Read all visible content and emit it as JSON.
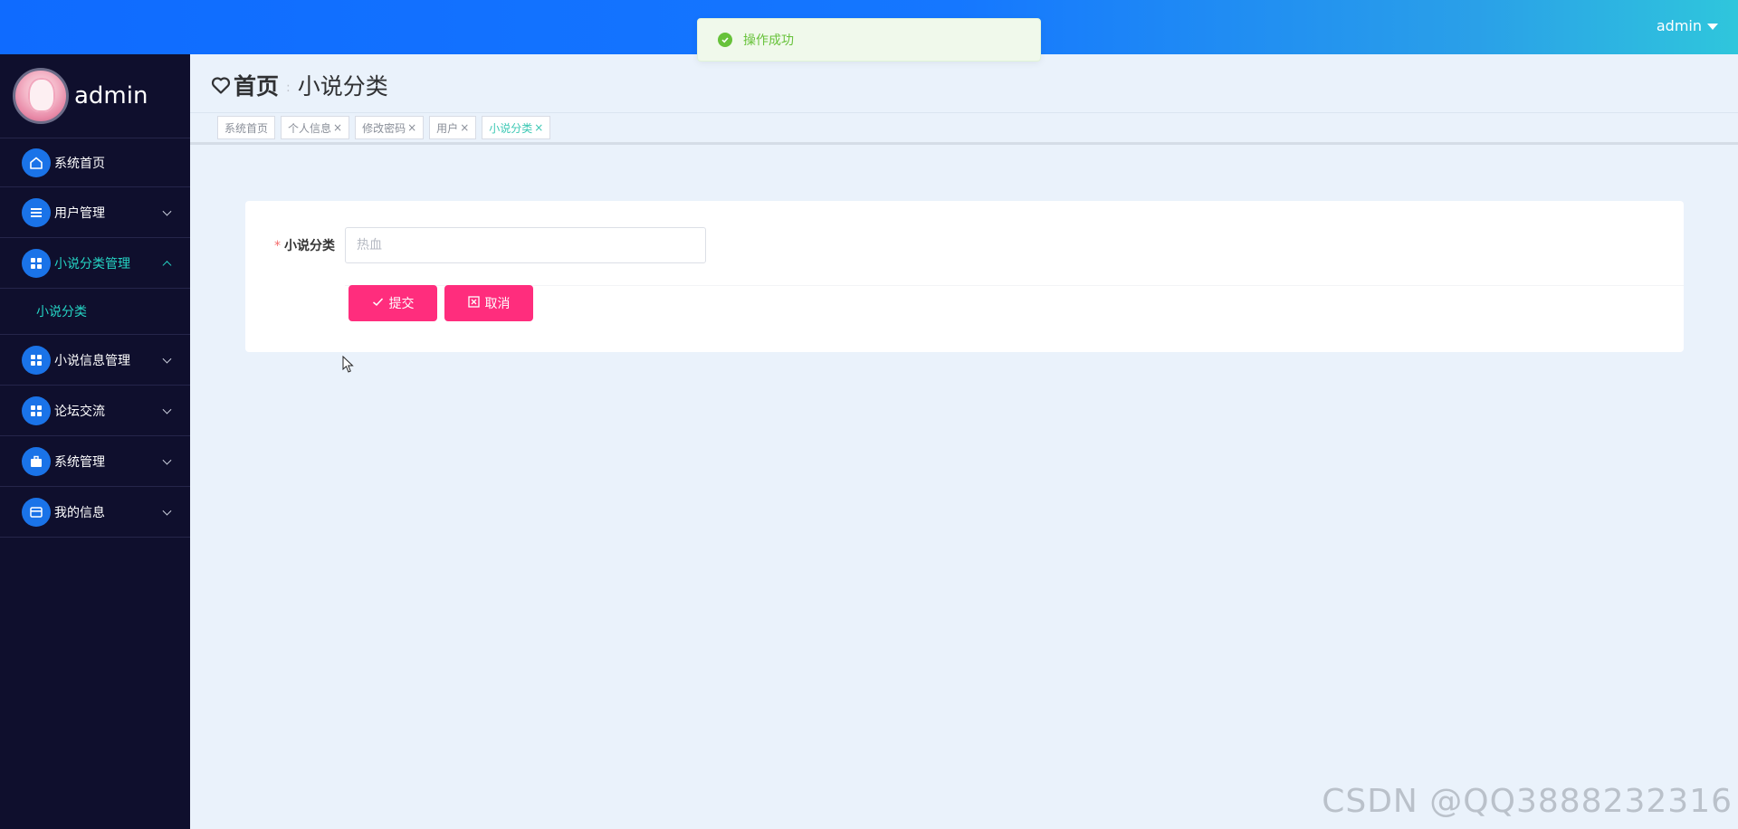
{
  "topbar": {
    "user_label": "admin"
  },
  "toast": {
    "message": "操作成功",
    "color": "#67c23a"
  },
  "sidebar": {
    "profile_name": "admin",
    "items": [
      {
        "label": "系统首页",
        "icon": "home-icon"
      },
      {
        "label": "用户管理",
        "icon": "list-icon"
      },
      {
        "label": "小说分类管理",
        "icon": "grid-icon",
        "expanded": true,
        "children": [
          {
            "label": "小说分类"
          }
        ]
      },
      {
        "label": "小说信息管理",
        "icon": "grid-icon"
      },
      {
        "label": "论坛交流",
        "icon": "grid-icon"
      },
      {
        "label": "系统管理",
        "icon": "briefcase-icon"
      },
      {
        "label": "我的信息",
        "icon": "wallet-icon"
      }
    ],
    "active_color": "#25d4c4"
  },
  "breadcrumb": {
    "home": "首页",
    "separator": ":",
    "current": "小说分类"
  },
  "tags": [
    {
      "label": "系统首页",
      "closable": false
    },
    {
      "label": "个人信息",
      "closable": true
    },
    {
      "label": "修改密码",
      "closable": true
    },
    {
      "label": "用户",
      "closable": true
    },
    {
      "label": "小说分类",
      "closable": true,
      "active": true
    }
  ],
  "tag_close_glyph": "×",
  "form": {
    "required_mark": "*",
    "field_label": "小说分类",
    "field_placeholder": "热血",
    "submit_label": "提交",
    "cancel_label": "取消",
    "button_color": "#ff2d7d"
  },
  "watermark": "CSDN @QQ3888232316"
}
